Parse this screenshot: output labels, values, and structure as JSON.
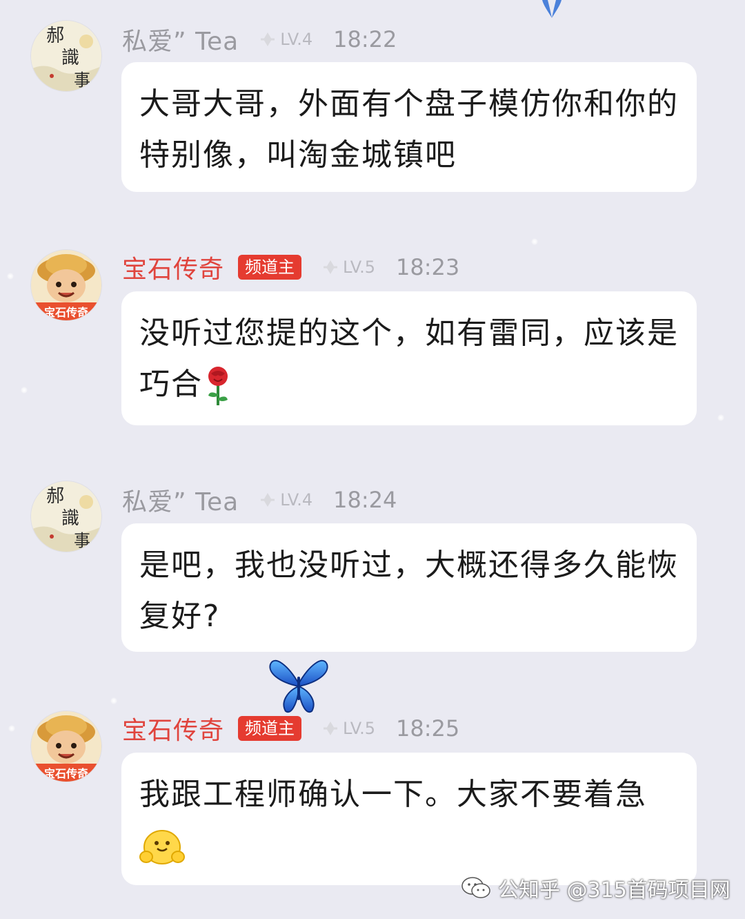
{
  "messages": [
    {
      "sender": "私爱” Tea",
      "level": "LV.4",
      "time": "18:22",
      "text": "大哥大哥，外面有个盘子模仿你和你的特别像，叫淘金城镇吧",
      "avatar_icon": "calligraphy-avatar-icon"
    },
    {
      "sender": "宝石传奇",
      "badge": "频道主",
      "level": "LV.5",
      "time": "18:23",
      "text": "没听过您提的这个，如有雷同，应该是巧合",
      "emoji": "rose-emoji-icon",
      "avatar_icon": "cartoon-boy-avatar-icon",
      "avatar_caption": "宝石传奇"
    },
    {
      "sender": "私爱” Tea",
      "level": "LV.4",
      "time": "18:24",
      "text": "是吧，我也没听过，大概还得多久能恢复好?",
      "avatar_icon": "calligraphy-avatar-icon"
    },
    {
      "sender": "宝石传奇",
      "badge": "频道主",
      "level": "LV.5",
      "time": "18:25",
      "text": "我跟工程师确认一下。大家不要着急",
      "emoji": "hug-face-emoji-icon",
      "avatar_icon": "cartoon-boy-avatar-icon",
      "avatar_caption": "宝石传奇"
    }
  ],
  "watermark": {
    "text": "公知乎 @315首码项目网",
    "icon": "wechat-icon"
  },
  "colors": {
    "background": "#eaeaf2",
    "owner_name": "#e0443d",
    "badge": "#e53b30",
    "bubble": "#ffffff",
    "meta_gray": "#9a9aa0"
  }
}
